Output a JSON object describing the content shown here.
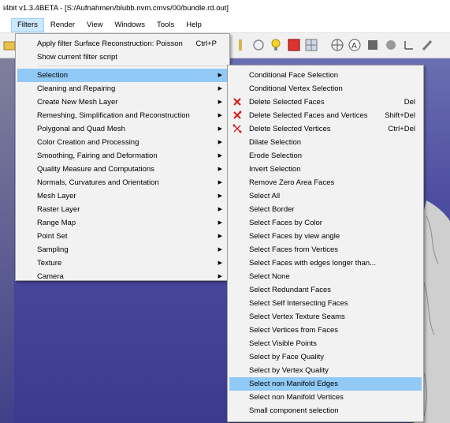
{
  "window": {
    "title": "i4bit v1.3.4BETA - [S:/Aufnahmen/blubb.nvm.cmvs/00/bundle.rd.out]"
  },
  "menubar": [
    {
      "label": "Filters",
      "active": true
    },
    {
      "label": "Render"
    },
    {
      "label": "View"
    },
    {
      "label": "Windows"
    },
    {
      "label": "Tools"
    },
    {
      "label": "Help"
    }
  ],
  "filters_menu": {
    "top_items": [
      {
        "label": "Apply filter Surface Reconstruction: Poisson",
        "shortcut": "Ctrl+P"
      },
      {
        "label": "Show current filter script",
        "shortcut": ""
      }
    ],
    "categories": [
      {
        "label": "Selection",
        "highlighted": true
      },
      {
        "label": "Cleaning and Repairing"
      },
      {
        "label": "Create New Mesh Layer"
      },
      {
        "label": "Remeshing, Simplification and Reconstruction"
      },
      {
        "label": "Polygonal and Quad Mesh"
      },
      {
        "label": "Color Creation and Processing"
      },
      {
        "label": "Smoothing, Fairing and Deformation"
      },
      {
        "label": "Quality Measure and Computations"
      },
      {
        "label": "Normals, Curvatures and Orientation"
      },
      {
        "label": "Mesh Layer"
      },
      {
        "label": "Raster Layer"
      },
      {
        "label": "Range Map"
      },
      {
        "label": "Point Set"
      },
      {
        "label": "Sampling"
      },
      {
        "label": "Texture"
      },
      {
        "label": "Camera"
      }
    ]
  },
  "selection_submenu": [
    {
      "label": "Conditional Face Selection"
    },
    {
      "label": "Conditional Vertex Selection"
    },
    {
      "label": "Delete Selected Faces",
      "shortcut": "Del",
      "icon": "delete-faces-icon"
    },
    {
      "label": "Delete Selected Faces and Vertices",
      "shortcut": "Shift+Del",
      "icon": "delete-faces-vertices-icon"
    },
    {
      "label": "Delete Selected Vertices",
      "shortcut": "Ctrl+Del",
      "icon": "delete-vertices-icon"
    },
    {
      "label": "Dilate Selection"
    },
    {
      "label": "Erode Selection"
    },
    {
      "label": "Invert Selection"
    },
    {
      "label": "Remove Zero Area Faces"
    },
    {
      "label": "Select All"
    },
    {
      "label": "Select Border"
    },
    {
      "label": "Select Faces by Color"
    },
    {
      "label": "Select Faces by view angle"
    },
    {
      "label": "Select Faces from Vertices"
    },
    {
      "label": "Select Faces with edges longer than..."
    },
    {
      "label": "Select None"
    },
    {
      "label": "Select Redundant Faces"
    },
    {
      "label": "Select Self Intersecting Faces"
    },
    {
      "label": "Select Vertex Texture Seams"
    },
    {
      "label": "Select Vertices from Faces"
    },
    {
      "label": "Select Visible Points"
    },
    {
      "label": "Select by Face Quality"
    },
    {
      "label": "Select by Vertex Quality"
    },
    {
      "label": "Select non Manifold Edges",
      "highlighted": true
    },
    {
      "label": "Select non Manifold Vertices"
    },
    {
      "label": "Small component selection"
    }
  ],
  "colors": {
    "highlight": "#91c9f7",
    "menu_bg": "#f2f2f2",
    "viewport_top": "#6a6fb0",
    "viewport_bottom": "#3a3a8e",
    "delete_icon": "#d42020"
  }
}
